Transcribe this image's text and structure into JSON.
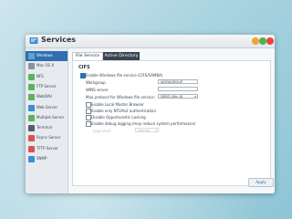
{
  "window": {
    "title": "Services"
  },
  "colors": {
    "accent": "#2f6fb1",
    "tab_dark": "#3b4552",
    "close": "#e6463c",
    "minimize": "#f0a432",
    "maximize": "#4fb04f"
  },
  "sidebar": {
    "items": [
      {
        "label": "Windows",
        "icon": "windows-icon",
        "color": "#5da3d9",
        "active": true
      },
      {
        "label": "Mac OS X",
        "icon": "apple-icon",
        "color": "#8a9299",
        "active": false
      },
      {
        "label": "NFS",
        "icon": "nfs-icon",
        "color": "#5bb35b",
        "active": false
      },
      {
        "label": "FTP Server",
        "icon": "ftp-icon",
        "color": "#5bb35b",
        "active": false
      },
      {
        "label": "WebDAV",
        "icon": "webdav-icon",
        "color": "#5bb35b",
        "active": false
      },
      {
        "label": "Web Server",
        "icon": "web-server-icon",
        "color": "#3c8fd0",
        "active": false
      },
      {
        "label": "Multiple Server",
        "icon": "multi-server-icon",
        "color": "#5bb35b",
        "active": false
      },
      {
        "label": "Terminal",
        "icon": "terminal-icon",
        "color": "#555d66",
        "active": false
      },
      {
        "label": "Rsync Server",
        "icon": "rsync-icon",
        "color": "#d9534f",
        "active": false
      },
      {
        "label": "TFTP Server",
        "icon": "tftp-icon",
        "color": "#d9534f",
        "active": false
      },
      {
        "label": "SNMP",
        "icon": "snmp-icon",
        "color": "#3c8fd0",
        "active": false
      }
    ]
  },
  "tabs": [
    "File Service",
    "Active Directory"
  ],
  "cifs": {
    "title": "CIFS",
    "enable_label": "Enable Windows file service (CIFS/SAMBA)",
    "enable_checked": true,
    "workgroup_label": "Workgroup",
    "workgroup_value": "WORKGROUP",
    "wins_label": "WINS server",
    "wins_value": "",
    "max_protocol_label": "Max protocol for Windows file service:",
    "max_protocol_value": "SMB3 (Win 8)",
    "options": [
      {
        "label": "Enable Local Master Browser",
        "checked": false
      },
      {
        "label": "Enable only NTLMv2 authentication",
        "checked": false
      },
      {
        "label": "Disable Opportunistic Locking",
        "checked": false
      },
      {
        "label": "Enable debug logging (may reduce system performance)",
        "checked": false
      }
    ],
    "log_level_label": "Log Level",
    "log_level_value": "Normal"
  },
  "buttons": {
    "apply": "Apply"
  }
}
